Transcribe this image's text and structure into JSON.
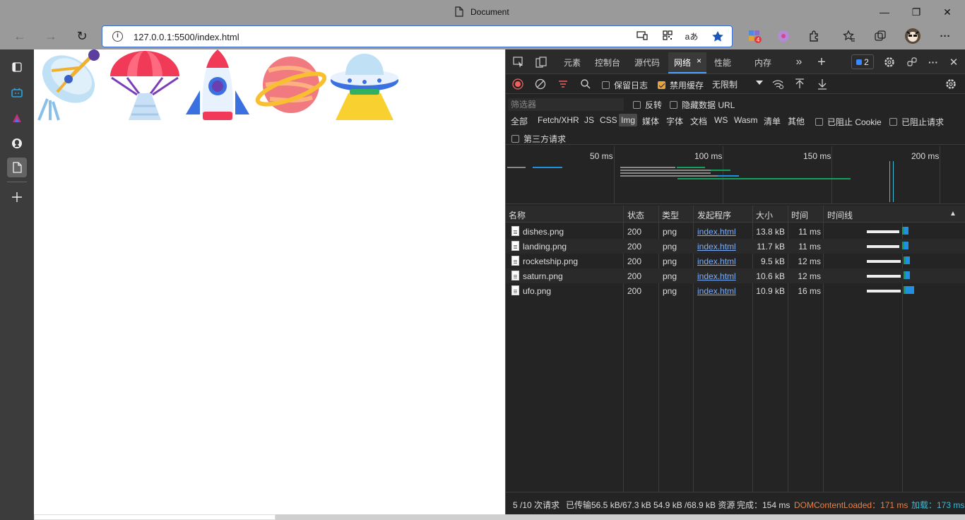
{
  "window": {
    "title": "Document",
    "minimize": "—",
    "restore": "❐",
    "close": "✕"
  },
  "toolbar": {
    "back": "←",
    "forward": "→",
    "refresh": "↻",
    "url": "127.0.0.1:5500/index.html",
    "info": "i",
    "read_aloud": "aあ",
    "extension_badge": "4",
    "more": "···"
  },
  "page": {
    "images": [
      "dishes.png",
      "landing.png",
      "rocketship.png",
      "saturn.png",
      "ufo.png"
    ]
  },
  "devtools": {
    "tabs": [
      "元素",
      "控制台",
      "源代码",
      "网络",
      "性能",
      "内存"
    ],
    "active_tab": "网络",
    "tab_close": "×",
    "more_tabs": "»",
    "add_tab": "+",
    "issues_count": "2",
    "more": "···",
    "close": "✕",
    "preserve_log": "保留日志",
    "disable_cache": "禁用缓存",
    "throttling": "无限制",
    "filter_placeholder": "筛选器",
    "invert": "反转",
    "hide_data_urls": "隐藏数据 URL",
    "resource_types": [
      "全部",
      "Fetch/XHR",
      "JS",
      "CSS",
      "Img",
      "媒体",
      "字体",
      "文档",
      "WS",
      "Wasm",
      "清单",
      "其他"
    ],
    "active_type": "Img",
    "blocked_cookies": "已阻止 Cookie",
    "blocked_requests": "已阻止请求",
    "third_party": "第三方请求",
    "overview_ticks": [
      "50 ms",
      "100 ms",
      "150 ms",
      "200 ms"
    ],
    "columns": [
      "名称",
      "状态",
      "类型",
      "发起程序",
      "大小",
      "时间",
      "时间线"
    ],
    "sort_indicator": "▲",
    "rows": [
      {
        "name": "dishes.png",
        "status": "200",
        "type": "png",
        "initiator": "index.html",
        "size": "13.8 kB",
        "time": "11 ms"
      },
      {
        "name": "landing.png",
        "status": "200",
        "type": "png",
        "initiator": "index.html",
        "size": "11.7 kB",
        "time": "11 ms"
      },
      {
        "name": "rocketship.png",
        "status": "200",
        "type": "png",
        "initiator": "index.html",
        "size": "9.5 kB",
        "time": "12 ms"
      },
      {
        "name": "saturn.png",
        "status": "200",
        "type": "png",
        "initiator": "index.html",
        "size": "10.6 kB",
        "time": "12 ms"
      },
      {
        "name": "ufo.png",
        "status": "200",
        "type": "png",
        "initiator": "index.html",
        "size": "10.9 kB",
        "time": "16 ms"
      }
    ],
    "status": {
      "requests": "5 /10 次请求",
      "transferred": "已传输56.5 kB/67.3 kB",
      "resources": "54.9 kB /68.9 kB 资源",
      "finish": "完成：154 ms",
      "dom_loaded": "DOMContentLoaded：171 ms",
      "load": "加载：173 ms"
    },
    "colors": {
      "dom_loaded": "#e8814a",
      "load": "#3dbcd6"
    }
  }
}
